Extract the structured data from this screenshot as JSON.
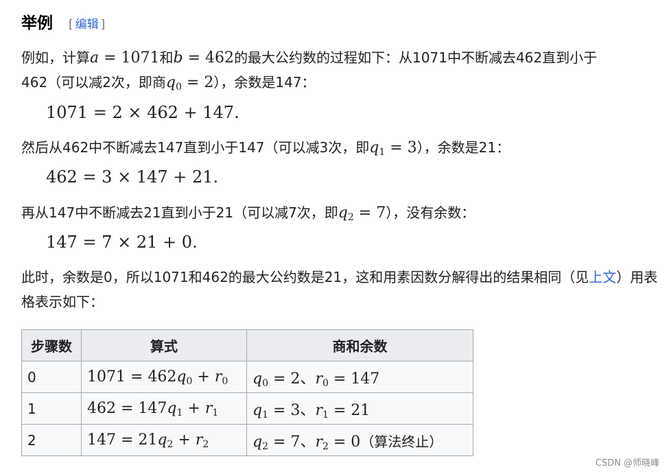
{
  "section": {
    "title": "举例",
    "edit_bracket_open": "[",
    "edit_label": "编辑",
    "edit_bracket_close": "]"
  },
  "paragraphs": {
    "p1": {
      "t1": "例如，计算",
      "m1_var": "a",
      "m1_rest": " = 1071",
      "t2": "和",
      "m2_var": "b",
      "m2_rest": " = 462",
      "t3": "的最大公约数的过程如下：从1071中不断减去462直到小于",
      "line2_t1": "462（可以减2次，即商",
      "m3_var": "q",
      "m3_sub": "0",
      "m3_rest": " = 2",
      "line2_t2": "），余数是147："
    },
    "eq1": "1071 = 2 × 462 + 147.",
    "p2": {
      "t1": "然后从462中不断减去147直到小于147（可以减3次，即",
      "m_var": "q",
      "m_sub": "1",
      "m_rest": " = 3",
      "t2": "），余数是21："
    },
    "eq2": "462 = 3 × 147 + 21.",
    "p3": {
      "t1": "再从147中不断减去21直到小于21（可以减7次，即",
      "m_var": "q",
      "m_sub": "2",
      "m_rest": " = 7",
      "t2": "），没有余数："
    },
    "eq3": "147 = 7 × 21 + 0.",
    "p4": {
      "t1": "此时，余数是0，所以1071和462的最大公约数是21，这和用素因数分解得出的结果相同（见",
      "link": "上文",
      "t2": "）用表格表示如下："
    }
  },
  "table": {
    "headers": [
      "步骤数",
      "算式",
      "商和余数"
    ],
    "rows": [
      {
        "step": "0",
        "lhs": "1071 = 462",
        "q": "q",
        "qs": "0",
        "plus": " + ",
        "r": "r",
        "rs": "0",
        "a_q": "q",
        "a_qs": "0",
        "a_qv": " = 2、",
        "a_r": "r",
        "a_rs": "0",
        "a_rv": " = 147",
        "note": ""
      },
      {
        "step": "1",
        "lhs": "462 = 147",
        "q": "q",
        "qs": "1",
        "plus": " + ",
        "r": "r",
        "rs": "1",
        "a_q": "q",
        "a_qs": "1",
        "a_qv": " = 3、",
        "a_r": "r",
        "a_rs": "1",
        "a_rv": " = 21",
        "note": ""
      },
      {
        "step": "2",
        "lhs": "147 = 21",
        "q": "q",
        "qs": "2",
        "plus": " + ",
        "r": "r",
        "rs": "2",
        "a_q": "q",
        "a_qs": "2",
        "a_qv": " = 7、",
        "a_r": "r",
        "a_rs": "2",
        "a_rv": " = 0",
        "note": "（算法终止）"
      }
    ]
  },
  "watermark": "CSDN @师晓峰",
  "colors": {
    "link": "#3366cc",
    "text": "#202122",
    "table_header_bg": "#eaecf0",
    "table_bg": "#f8f9fa",
    "table_border": "#a2a9b1"
  }
}
